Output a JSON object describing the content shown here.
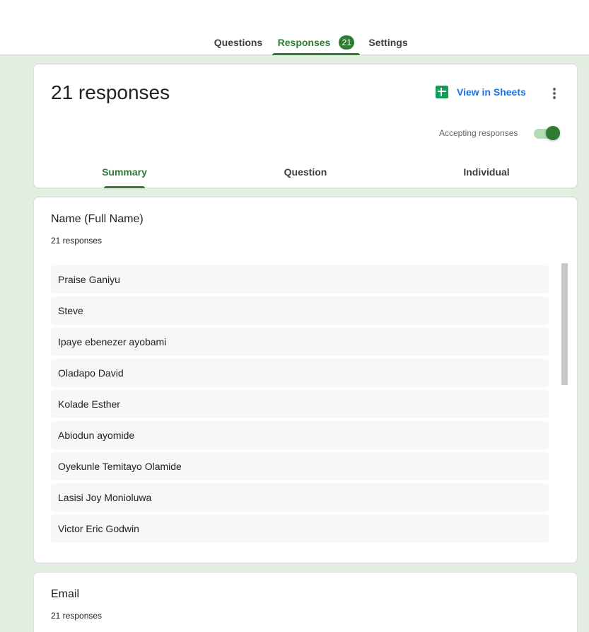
{
  "top_tabs": {
    "questions": "Questions",
    "responses": "Responses",
    "responses_count": "21",
    "settings": "Settings"
  },
  "header": {
    "title": "21 responses",
    "view_in_sheets": "View in Sheets",
    "accepting_label": "Accepting responses",
    "accepting_on": true
  },
  "sub_tabs": {
    "summary": "Summary",
    "question": "Question",
    "individual": "Individual"
  },
  "name_question": {
    "title": "Name (Full Name)",
    "count": "21 responses",
    "responses": [
      "Praise Ganiyu",
      "Steve",
      "Ipaye ebenezer ayobami",
      "Oladapo David",
      "Kolade Esther",
      "Abiodun ayomide",
      "Oyekunle Temitayo Olamide",
      "Lasisi Joy Monioluwa",
      "Victor Eric Godwin"
    ]
  },
  "email_question": {
    "title": "Email",
    "count": "21 responses"
  },
  "icons": {
    "sheets": "sheets-icon",
    "more": "more-vert-icon"
  },
  "colors": {
    "accent": "#2e7d32",
    "link": "#1a73e8",
    "sheets": "#0f9d58",
    "background": "#e3ede1"
  }
}
